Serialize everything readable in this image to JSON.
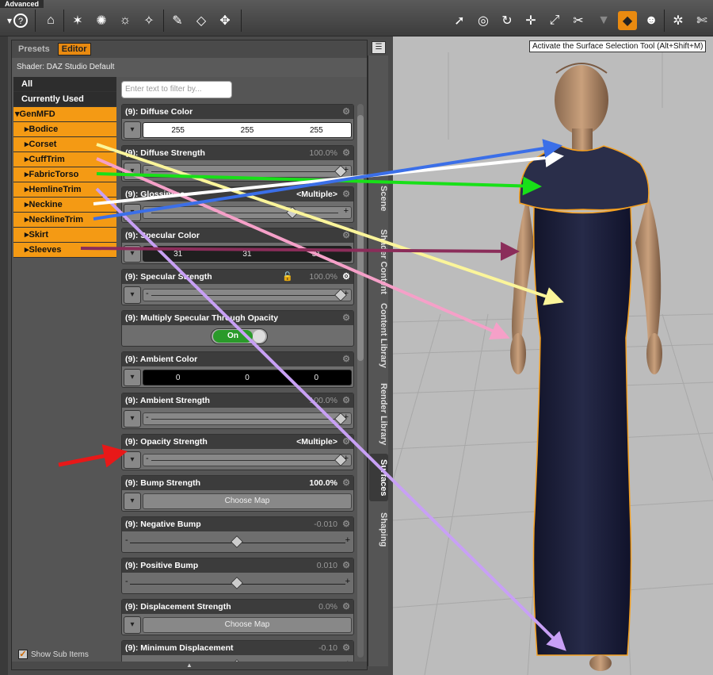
{
  "toolbar": {
    "advanced_tab": "Advanced",
    "tooltip": "Activate the Surface Selection Tool (Alt+Shift+M)",
    "icons": [
      "help-icon",
      "scene-camera-icon",
      "light-icon",
      "spotlight-icon",
      "sun-icon",
      "render-icon",
      "paint-icon",
      "primitive-icon",
      "dform-icon",
      "select-icon",
      "orbit-icon",
      "rotate-icon",
      "translate-icon",
      "scale-icon",
      "joint-icon",
      "geometry-icon",
      "surface-selection-icon",
      "figure-icon",
      "node-icon",
      "tools-icon"
    ]
  },
  "panel": {
    "tabs": [
      "Presets",
      "Editor"
    ],
    "shader_label": "Shader: DAZ Studio Default",
    "filter_placeholder": "Enter text to filter by...",
    "show_sub_items": "Show Sub Items"
  },
  "tree": {
    "top": [
      "All",
      "Currently Used"
    ],
    "group": "GenMFD",
    "children": [
      "Bodice",
      "Corset",
      "CuffTrim",
      "FabricTorso",
      "HemlineTrim",
      "Neckine",
      "NecklineTrim",
      "Skirt",
      "Sleeves"
    ]
  },
  "properties": [
    {
      "name": "(9): Diffuse Color",
      "kind": "color",
      "rgb": [
        "255",
        "255",
        "255"
      ],
      "field_color": "#ffffff",
      "text_color": "#111111"
    },
    {
      "name": "(9): Diffuse Strength",
      "kind": "slider",
      "value": "100.0%",
      "dim": true,
      "knob": 1.0
    },
    {
      "name": "(9): Glossiness",
      "kind": "slider",
      "value": "<Multiple>",
      "dim": false,
      "knob": 0.75
    },
    {
      "name": "(9): Specular Color",
      "kind": "color",
      "rgb": [
        "31",
        "31",
        "31"
      ],
      "field_color": "#1f1f1f",
      "text_color": "#eeeeee"
    },
    {
      "name": "(9): Specular Strength",
      "kind": "slider",
      "value": "100.0%",
      "dim": true,
      "knob": 1.0,
      "lock": true
    },
    {
      "name": "(9): Multiply Specular Through Opacity",
      "kind": "toggle",
      "toggle_label": "On"
    },
    {
      "name": "(9): Ambient Color",
      "kind": "color",
      "rgb": [
        "0",
        "0",
        "0"
      ],
      "field_color": "#000000",
      "text_color": "#eeeeee"
    },
    {
      "name": "(9): Ambient Strength",
      "kind": "slider",
      "value": "100.0%",
      "dim": true,
      "knob": 1.0
    },
    {
      "name": "(9): Opacity Strength",
      "kind": "slider",
      "value": "<Multiple>",
      "dim": false,
      "knob": 1.0
    },
    {
      "name": "(9): Bump Strength",
      "kind": "map",
      "value": "100.0%",
      "dim": false,
      "map_label": "Choose Map"
    },
    {
      "name": "(9): Negative Bump",
      "kind": "bump",
      "value": "-0.010",
      "dim": true,
      "knob": 0.5
    },
    {
      "name": "(9): Positive Bump",
      "kind": "bump",
      "value": "0.010",
      "dim": true,
      "knob": 0.5
    },
    {
      "name": "(9): Displacement Strength",
      "kind": "map",
      "value": "0.0%",
      "dim": true,
      "map_label": "Choose Map"
    },
    {
      "name": "(9): Minimum Displacement",
      "kind": "bump",
      "value": "-0.10",
      "dim": true,
      "knob": 0.5
    }
  ],
  "side_tabs": [
    {
      "label": "Scene",
      "selected": false
    },
    {
      "label": "Shader Content",
      "selected": false
    },
    {
      "label": "Content Library",
      "selected": false
    },
    {
      "label": "Render Library",
      "selected": false
    },
    {
      "label": "Surfaces",
      "selected": true
    },
    {
      "label": "Shaping",
      "selected": false
    }
  ],
  "colors": {
    "accent": "#f49a14",
    "selection_outline": "#f5a020",
    "dress": "#1c1e33",
    "skin": "#b9906f",
    "arrow_blue": "#3b6fe8",
    "arrow_white": "#ffffff",
    "arrow_green": "#18e018",
    "arrow_yellow": "#fbf59a",
    "arrow_pink": "#f5a0c8",
    "arrow_purple": "#c8a0f5",
    "arrow_maroon": "#8b2d5a",
    "arrow_red": "#e81818"
  }
}
